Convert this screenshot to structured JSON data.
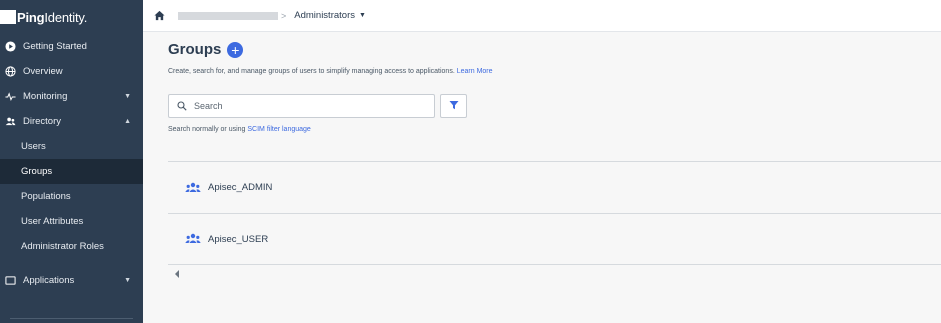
{
  "brand": {
    "name_bold": "Ping",
    "name_rest": "Identity."
  },
  "sidebar": {
    "items": [
      {
        "label": "Getting Started",
        "icon": "play-circle-icon"
      },
      {
        "label": "Overview",
        "icon": "globe-icon"
      },
      {
        "label": "Monitoring",
        "icon": "pulse-icon",
        "chevron": "▼"
      },
      {
        "label": "Directory",
        "icon": "users-icon",
        "chevron": "▲"
      }
    ],
    "directory_subitems": [
      {
        "label": "Users"
      },
      {
        "label": "Groups",
        "active": true
      },
      {
        "label": "Populations"
      },
      {
        "label": "User Attributes"
      },
      {
        "label": "Administrator Roles"
      }
    ],
    "applications": {
      "label": "Applications",
      "icon": "window-icon",
      "chevron": "▼"
    }
  },
  "topbar": {
    "separator": ">",
    "current": "Administrators",
    "caret": "▼"
  },
  "page": {
    "title": "Groups",
    "add_symbol": "+",
    "description": "Create, search for, and manage groups of users to simplify managing access to applications.",
    "learn_more": "Learn More"
  },
  "search": {
    "placeholder": "Search",
    "hint_prefix": "Search normally or using",
    "hint_link": "SCIM filter language"
  },
  "groups": [
    {
      "name": "Apisec_ADMIN"
    },
    {
      "name": "Apisec_USER"
    }
  ],
  "colors": {
    "sidebar_bg": "#2d3e52",
    "accent": "#3d6ae0",
    "active_item_bg": "#1d2a38"
  }
}
